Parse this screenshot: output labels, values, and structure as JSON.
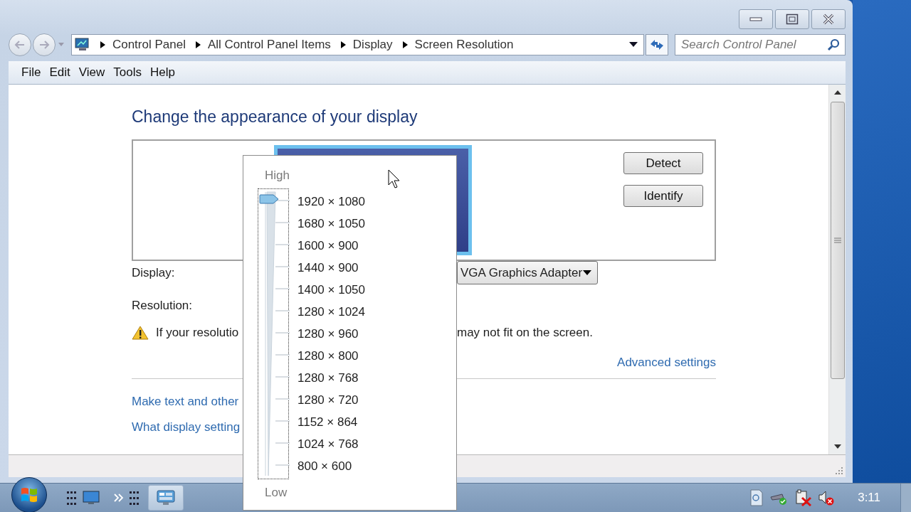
{
  "address_bar": {
    "breadcrumbs": [
      "Control Panel",
      "All Control Panel Items",
      "Display",
      "Screen Resolution"
    ]
  },
  "search": {
    "placeholder": "Search Control Panel"
  },
  "menu": [
    "File",
    "Edit",
    "View",
    "Tools",
    "Help"
  ],
  "heading": "Change the appearance of your display",
  "preview": {
    "buttons": [
      "Detect",
      "Identify"
    ]
  },
  "display": {
    "label": "Display:",
    "value": "VGA Graphics Adapter"
  },
  "resolution": {
    "label": "Resolution:",
    "slider": {
      "level": 1,
      "top_label": "High",
      "bottom_label": "Low",
      "options": [
        "1920 × 1080",
        "1680 × 1050",
        "1600 × 900",
        "1440 × 900",
        "1400 × 1050",
        "1280 × 1024",
        "1280 × 960",
        "1280 × 800",
        "1280 × 768",
        "1280 × 720",
        "1152 × 864",
        "1024 × 768",
        "800 × 600"
      ]
    }
  },
  "warning": {
    "start": "If your resolutio",
    "end": "may not fit on the screen."
  },
  "advanced_link": "Advanced settings",
  "links": [
    "Make text and other",
    "What display setting"
  ],
  "taskbar": {
    "clock": "3:11"
  }
}
